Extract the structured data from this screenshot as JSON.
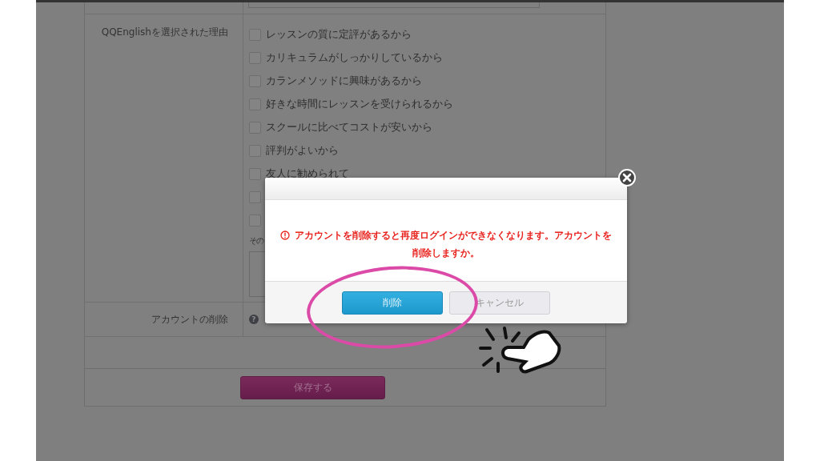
{
  "form": {
    "reasons": {
      "label": "QQEnglishを選択された理由",
      "options": [
        {
          "label": "レッスンの質に定評があるから",
          "checked": false
        },
        {
          "label": "カリキュラムがしっかりしているから",
          "checked": false
        },
        {
          "label": "カランメソッドに興味があるから",
          "checked": false
        },
        {
          "label": "好きな時間にレッスンを受けられるから",
          "checked": false
        },
        {
          "label": "スクールに比べてコストが安いから",
          "checked": false
        },
        {
          "label": "評判がよいから",
          "checked": false
        },
        {
          "label": "友人に勧められて",
          "checked": false
        },
        {
          "checked": false
        },
        {
          "checked": false
        }
      ],
      "other_label": "その"
    },
    "account_delete": {
      "label": "アカウントの削除",
      "help_icon": "?"
    },
    "save_button": "保存する"
  },
  "dialog": {
    "message": "アカウントを削除すると再度ログインができなくなります。アカウントを削除しますか。",
    "buttons": [
      {
        "label": "削除",
        "kind": "primary"
      },
      {
        "label": "キャンセル",
        "kind": "secondary"
      }
    ]
  }
}
